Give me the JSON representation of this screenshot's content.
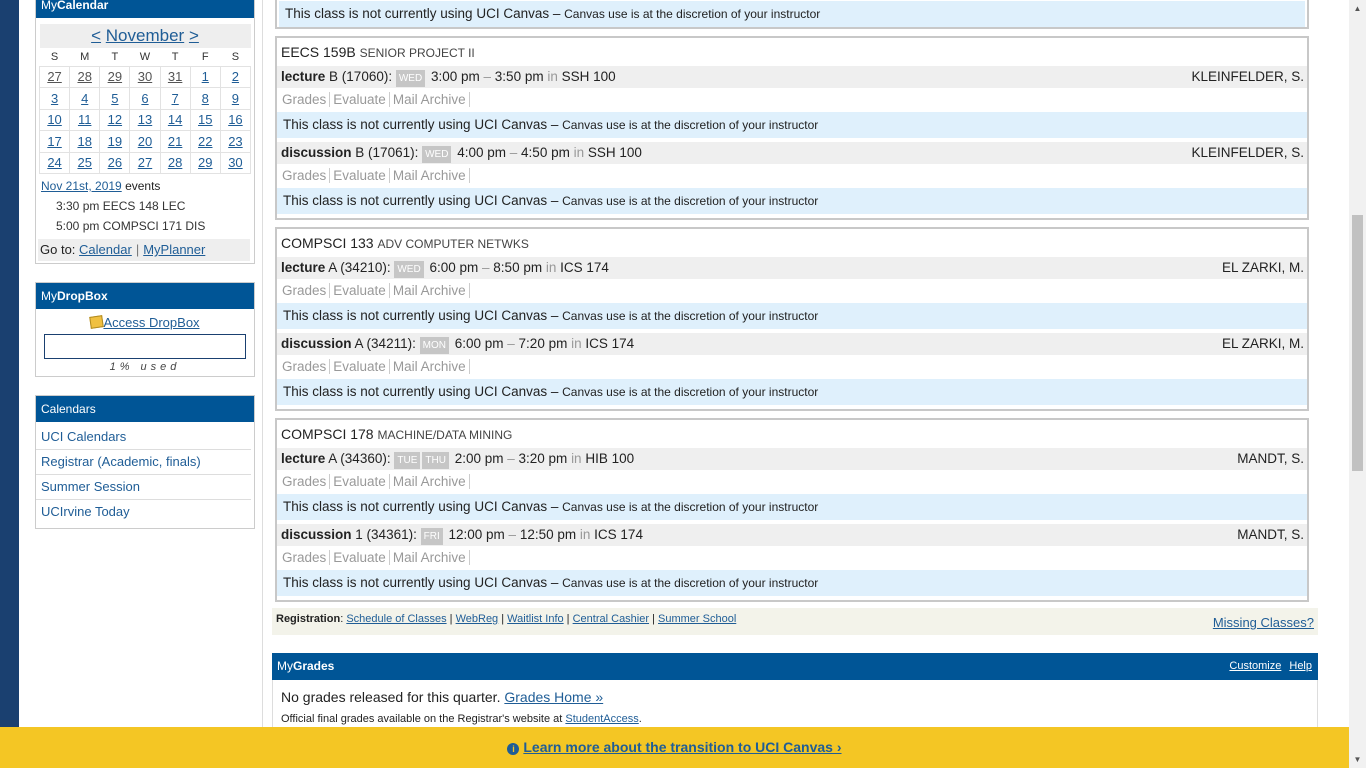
{
  "calendar": {
    "panel_title_pre": "My",
    "panel_title_bold": "Calendar",
    "prev": "<",
    "month": "November",
    "next": ">",
    "dow": [
      "S",
      "M",
      "T",
      "W",
      "T",
      "F",
      "S"
    ],
    "weeks": [
      [
        "27",
        "28",
        "29",
        "30",
        "31",
        "1",
        "2"
      ],
      [
        "3",
        "4",
        "5",
        "6",
        "7",
        "8",
        "9"
      ],
      [
        "10",
        "11",
        "12",
        "13",
        "14",
        "15",
        "16"
      ],
      [
        "17",
        "18",
        "19",
        "20",
        "21",
        "22",
        "23"
      ],
      [
        "24",
        "25",
        "26",
        "27",
        "28",
        "29",
        "30"
      ]
    ],
    "selected_date": "Nov 21st, 2019",
    "events_label": "events",
    "events": [
      "3:30 pm EECS 148 LEC",
      "5:00 pm COMPSCI 171 DIS"
    ],
    "goto_label": "Go to:",
    "goto_calendar": "Calendar",
    "goto_sep": "|",
    "goto_planner": "MyPlanner"
  },
  "dropbox": {
    "title_pre": "My",
    "title_bold": "DropBox",
    "link": "Access DropBox",
    "usage": "1% used"
  },
  "calendars": {
    "title": "Calendars",
    "items": [
      "UCI Calendars",
      "Registrar (Academic, finals)",
      "Summer Session",
      "UCIrvine Today"
    ]
  },
  "top_message": {
    "text": "This class is not currently using UCI Canvas –",
    "small": "Canvas use is at the discretion of your instructor"
  },
  "canvas_msg": {
    "text": "This class is not currently using UCI Canvas –",
    "small": "Canvas use is at the discretion of your instructor"
  },
  "tools": [
    "Grades",
    "Evaluate",
    "Mail Archive"
  ],
  "courses": [
    {
      "code": "EECS 159B",
      "name": "SENIOR PROJECT II",
      "sections": [
        {
          "type": "lecture",
          "id": "B (17060):",
          "days": [
            "WED"
          ],
          "start": "3:00 pm",
          "end": "3:50 pm",
          "loc": "SSH 100",
          "instructor": "KLEINFELDER, S."
        },
        {
          "type": "discussion",
          "id": "B (17061):",
          "days": [
            "WED"
          ],
          "start": "4:00 pm",
          "end": "4:50 pm",
          "loc": "SSH 100",
          "instructor": "KLEINFELDER, S."
        }
      ]
    },
    {
      "code": "COMPSCI 133",
      "name": "ADV COMPUTER NETWKS",
      "sections": [
        {
          "type": "lecture",
          "id": "A (34210):",
          "days": [
            "WED"
          ],
          "start": "6:00 pm",
          "end": "8:50 pm",
          "loc": "ICS 174",
          "instructor": "EL ZARKI, M."
        },
        {
          "type": "discussion",
          "id": "A (34211):",
          "days": [
            "MON"
          ],
          "start": "6:00 pm",
          "end": "7:20 pm",
          "loc": "ICS 174",
          "instructor": "EL ZARKI, M."
        }
      ]
    },
    {
      "code": "COMPSCI 178",
      "name": "MACHINE/DATA MINING",
      "sections": [
        {
          "type": "lecture",
          "id": "A (34360):",
          "days": [
            "TUE",
            "THU"
          ],
          "start": "2:00 pm",
          "end": "3:20 pm",
          "loc": "HIB 100",
          "instructor": "MANDT, S."
        },
        {
          "type": "discussion",
          "id": "1 (34361):",
          "days": [
            "FRI"
          ],
          "start": "12:00 pm",
          "end": "12:50 pm",
          "loc": "ICS 174",
          "instructor": "MANDT, S."
        }
      ]
    }
  ],
  "time_sep": "–",
  "in_word": "in",
  "registration": {
    "label": "Registration",
    "links": [
      "Schedule of Classes",
      "WebReg",
      "Waitlist Info",
      "Central Cashier",
      "Summer School"
    ],
    "missing": "Missing Classes?"
  },
  "grades": {
    "title_pre": "My",
    "title_bold": "Grades",
    "customize": "Customize",
    "help": "Help",
    "message": "No grades released for this quarter.",
    "link": "Grades Home »",
    "note": "Official final grades available on the Registrar's website at",
    "note_link": "StudentAccess",
    "note_end": "."
  },
  "banner": {
    "text": "Learn more about the transition to UCI Canvas ›"
  }
}
